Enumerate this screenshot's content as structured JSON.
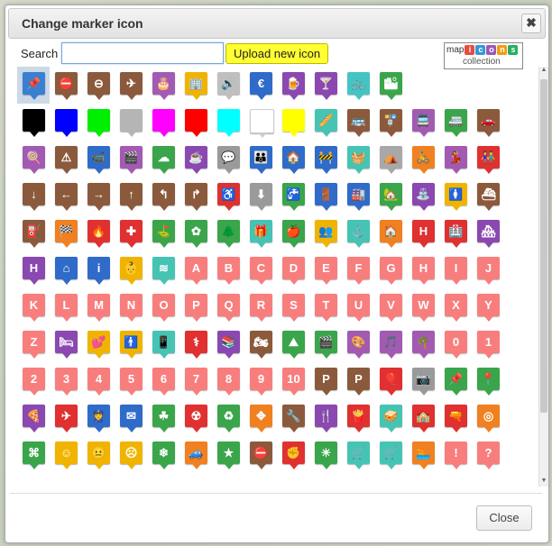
{
  "dialog": {
    "title": "Change marker icon",
    "close_glyph": "✖",
    "search_label": "Search",
    "search_value": "",
    "upload_label": "Upload new icon",
    "close_label": "Close"
  },
  "logo": {
    "prefix": "map",
    "letters": [
      {
        "ch": "i",
        "color": "#e74c3c"
      },
      {
        "ch": "c",
        "color": "#3498db"
      },
      {
        "ch": "o",
        "color": "#9b59b6"
      },
      {
        "ch": "n",
        "color": "#f39c12"
      },
      {
        "ch": "s",
        "color": "#27ae60"
      }
    ],
    "subtitle": "collection"
  },
  "icons": [
    {
      "name": "pushpin-icon",
      "color": "#3a7fd0",
      "glyph": "📌",
      "selected": true
    },
    {
      "name": "no-entry-icon",
      "color": "#8b5a3c",
      "glyph": "⛔"
    },
    {
      "name": "no-entry-alt-icon",
      "color": "#8b5a3c",
      "glyph": "⊖"
    },
    {
      "name": "airport-icon",
      "color": "#8b5a3c",
      "glyph": "✈"
    },
    {
      "name": "birthday-cake-icon",
      "color": "#a35ab3",
      "glyph": "🎂"
    },
    {
      "name": "building-icon",
      "color": "#f0b400",
      "glyph": "🏢"
    },
    {
      "name": "loudspeaker-icon",
      "color": "#bfbfbf",
      "glyph": "🔊"
    },
    {
      "name": "euro-money-icon",
      "color": "#2f6bc9",
      "glyph": "€"
    },
    {
      "name": "beer-icon",
      "color": "#8a48b0",
      "glyph": "🍺"
    },
    {
      "name": "bar-icon",
      "color": "#8a48b0",
      "glyph": "🍸"
    },
    {
      "name": "bicycle-icon",
      "color": "#45c4c4",
      "glyph": "🚲"
    },
    {
      "name": "city-icon",
      "color": "#3aa54a",
      "glyph": "🏙"
    },
    {
      "name": "black-marker-icon",
      "color": "#000000",
      "glyph": ""
    },
    {
      "name": "blue-marker-icon",
      "color": "#0000ff",
      "glyph": ""
    },
    {
      "name": "green-marker-icon",
      "color": "#00ee00",
      "glyph": ""
    },
    {
      "name": "gray-marker-icon",
      "color": "#b5b5b5",
      "glyph": ""
    },
    {
      "name": "magenta-marker-icon",
      "color": "#ff00ff",
      "glyph": ""
    },
    {
      "name": "red-marker-icon",
      "color": "#ff0000",
      "glyph": ""
    },
    {
      "name": "cyan-marker-icon",
      "color": "#00ffff",
      "glyph": ""
    },
    {
      "name": "white-marker-icon",
      "color": "#ffffff",
      "glyph": "",
      "white": true
    },
    {
      "name": "yellow-marker-icon",
      "color": "#ffff00",
      "glyph": ""
    },
    {
      "name": "bakery-icon",
      "color": "#45c4b4",
      "glyph": "🥖"
    },
    {
      "name": "bus-icon",
      "color": "#8b5a3c",
      "glyph": "🚌"
    },
    {
      "name": "bus-stop-icon",
      "color": "#8b5a3c",
      "glyph": "🚏"
    },
    {
      "name": "bus-tour-icon",
      "color": "#a35ab3",
      "glyph": "🚍"
    },
    {
      "name": "camper-icon",
      "color": "#3aa54a",
      "glyph": "🚐"
    },
    {
      "name": "car-icon",
      "color": "#8b5a3c",
      "glyph": "🚗"
    },
    {
      "name": "candy-icon",
      "color": "#a35ab3",
      "glyph": "🍭"
    },
    {
      "name": "caution-icon",
      "color": "#8b5a3c",
      "glyph": "⚠"
    },
    {
      "name": "cctv-icon",
      "color": "#2f6bc9",
      "glyph": "📹"
    },
    {
      "name": "cinema-icon",
      "color": "#a35ab3",
      "glyph": "🎬"
    },
    {
      "name": "cloud-icon",
      "color": "#3aa54a",
      "glyph": "☁"
    },
    {
      "name": "coffee-icon",
      "color": "#8a48b0",
      "glyph": "☕"
    },
    {
      "name": "chat-icon",
      "color": "#9a9a9a",
      "glyph": "💬"
    },
    {
      "name": "community-icon",
      "color": "#2f6bc9",
      "glyph": "👪"
    },
    {
      "name": "conservation-icon",
      "color": "#2f6bc9",
      "glyph": "🏠"
    },
    {
      "name": "construction-icon",
      "color": "#2f6bc9",
      "glyph": "🚧"
    },
    {
      "name": "shopping-basket-icon",
      "color": "#45c4b4",
      "glyph": "🧺"
    },
    {
      "name": "dome-icon",
      "color": "#a8a8a8",
      "glyph": "⛺"
    },
    {
      "name": "cycling-icon",
      "color": "#f08020",
      "glyph": "🚴"
    },
    {
      "name": "dancing-icon",
      "color": "#a35ab3",
      "glyph": "💃"
    },
    {
      "name": "daycare-icon",
      "color": "#e03030",
      "glyph": "👫"
    },
    {
      "name": "arrow-down-icon",
      "color": "#8b5a3c",
      "glyph": "↓"
    },
    {
      "name": "arrow-left-icon",
      "color": "#8b5a3c",
      "glyph": "←"
    },
    {
      "name": "arrow-right-icon",
      "color": "#8b5a3c",
      "glyph": "→"
    },
    {
      "name": "arrow-up-icon",
      "color": "#8b5a3c",
      "glyph": "↑"
    },
    {
      "name": "turn-left-icon",
      "color": "#8b5a3c",
      "glyph": "↰"
    },
    {
      "name": "turn-right-icon",
      "color": "#8b5a3c",
      "glyph": "↱"
    },
    {
      "name": "disability-icon",
      "color": "#e03030",
      "glyph": "♿"
    },
    {
      "name": "download-icon",
      "color": "#9a9a9a",
      "glyph": "⬇"
    },
    {
      "name": "drinking-water-icon",
      "color": "#3aa54a",
      "glyph": "🚰"
    },
    {
      "name": "exit-icon",
      "color": "#2f6bc9",
      "glyph": "🚪"
    },
    {
      "name": "factory-icon",
      "color": "#2f6bc9",
      "glyph": "🏭"
    },
    {
      "name": "farm-icon",
      "color": "#3aa54a",
      "glyph": "🏡"
    },
    {
      "name": "fountain-icon",
      "color": "#8a48b0",
      "glyph": "⛲"
    },
    {
      "name": "woman-icon",
      "color": "#f0b400",
      "glyph": "🚺"
    },
    {
      "name": "ferry-icon",
      "color": "#8b5a3c",
      "glyph": "⛴"
    },
    {
      "name": "gas-station-icon",
      "color": "#8b5a3c",
      "glyph": "⛽"
    },
    {
      "name": "finish-flag-icon",
      "color": "#f08020",
      "glyph": "🏁"
    },
    {
      "name": "fire-icon",
      "color": "#e03030",
      "glyph": "🔥"
    },
    {
      "name": "first-aid-icon",
      "color": "#e03030",
      "glyph": "✚"
    },
    {
      "name": "golf-icon",
      "color": "#3aa54a",
      "glyph": "⛳"
    },
    {
      "name": "flower-icon",
      "color": "#3aa54a",
      "glyph": "✿"
    },
    {
      "name": "forest-icon",
      "color": "#3aa54a",
      "glyph": "🌲"
    },
    {
      "name": "gift-icon",
      "color": "#45c4b4",
      "glyph": "🎁"
    },
    {
      "name": "grocery-icon",
      "color": "#3aa54a",
      "glyph": "🍎"
    },
    {
      "name": "group-icon",
      "color": "#f0b400",
      "glyph": "👥"
    },
    {
      "name": "harbor-icon",
      "color": "#45c4b4",
      "glyph": "⚓"
    },
    {
      "name": "home-icon",
      "color": "#f08020",
      "glyph": "🏠"
    },
    {
      "name": "hospital-icon",
      "color": "#e03030",
      "glyph": "H"
    },
    {
      "name": "hospital-building-icon",
      "color": "#e03030",
      "glyph": "🏥"
    },
    {
      "name": "house-row-icon",
      "color": "#8a48b0",
      "glyph": "🏘"
    },
    {
      "name": "hotel-icon",
      "color": "#8a48b0",
      "glyph": "H"
    },
    {
      "name": "igloo-icon",
      "color": "#2f6bc9",
      "glyph": "⌂"
    },
    {
      "name": "info-icon",
      "color": "#2f6bc9",
      "glyph": "i"
    },
    {
      "name": "kids-icon",
      "color": "#f0b400",
      "glyph": "👶"
    },
    {
      "name": "lake-icon",
      "color": "#45c4b4",
      "glyph": "≋"
    },
    {
      "name": "letter-a-icon",
      "color": "#f87e7e",
      "glyph": "A"
    },
    {
      "name": "letter-b-icon",
      "color": "#f87e7e",
      "glyph": "B"
    },
    {
      "name": "letter-c-icon",
      "color": "#f87e7e",
      "glyph": "C"
    },
    {
      "name": "letter-d-icon",
      "color": "#f87e7e",
      "glyph": "D"
    },
    {
      "name": "letter-e-icon",
      "color": "#f87e7e",
      "glyph": "E"
    },
    {
      "name": "letter-f-icon",
      "color": "#f87e7e",
      "glyph": "F"
    },
    {
      "name": "letter-g-icon",
      "color": "#f87e7e",
      "glyph": "G"
    },
    {
      "name": "letter-h-icon",
      "color": "#f87e7e",
      "glyph": "H"
    },
    {
      "name": "letter-i-icon",
      "color": "#f87e7e",
      "glyph": "I"
    },
    {
      "name": "letter-j-icon",
      "color": "#f87e7e",
      "glyph": "J"
    },
    {
      "name": "letter-k-icon",
      "color": "#f87e7e",
      "glyph": "K"
    },
    {
      "name": "letter-l-icon",
      "color": "#f87e7e",
      "glyph": "L"
    },
    {
      "name": "letter-m-icon",
      "color": "#f87e7e",
      "glyph": "M"
    },
    {
      "name": "letter-n-icon",
      "color": "#f87e7e",
      "glyph": "N"
    },
    {
      "name": "letter-o-icon",
      "color": "#f87e7e",
      "glyph": "O"
    },
    {
      "name": "letter-p-icon",
      "color": "#f87e7e",
      "glyph": "P"
    },
    {
      "name": "letter-q-icon",
      "color": "#f87e7e",
      "glyph": "Q"
    },
    {
      "name": "letter-r-icon",
      "color": "#f87e7e",
      "glyph": "R"
    },
    {
      "name": "letter-s-icon",
      "color": "#f87e7e",
      "glyph": "S"
    },
    {
      "name": "letter-t-icon",
      "color": "#f87e7e",
      "glyph": "T"
    },
    {
      "name": "letter-u-icon",
      "color": "#f87e7e",
      "glyph": "U"
    },
    {
      "name": "letter-v-icon",
      "color": "#f87e7e",
      "glyph": "V"
    },
    {
      "name": "letter-w-icon",
      "color": "#f87e7e",
      "glyph": "W"
    },
    {
      "name": "letter-x-icon",
      "color": "#f87e7e",
      "glyph": "X"
    },
    {
      "name": "letter-y-icon",
      "color": "#f87e7e",
      "glyph": "Y"
    },
    {
      "name": "letter-z-icon",
      "color": "#f87e7e",
      "glyph": "Z"
    },
    {
      "name": "lodging-icon",
      "color": "#8a48b0",
      "glyph": "🛏"
    },
    {
      "name": "love-icon",
      "color": "#f0b400",
      "glyph": "💕"
    },
    {
      "name": "man-icon",
      "color": "#f0b400",
      "glyph": "🚹"
    },
    {
      "name": "mobile-phone-icon",
      "color": "#45c4b4",
      "glyph": "📱"
    },
    {
      "name": "medicine-icon",
      "color": "#e03030",
      "glyph": "⚕"
    },
    {
      "name": "library-icon",
      "color": "#8a48b0",
      "glyph": "📚"
    },
    {
      "name": "motorbike-icon",
      "color": "#8b5a3c",
      "glyph": "🏍"
    },
    {
      "name": "mountains-icon",
      "color": "#3aa54a",
      "glyph": "⛰"
    },
    {
      "name": "movie-icon",
      "color": "#3aa54a",
      "glyph": "🎬"
    },
    {
      "name": "painting-icon",
      "color": "#a35ab3",
      "glyph": "🎨"
    },
    {
      "name": "music-icon",
      "color": "#a35ab3",
      "glyph": "🎵"
    },
    {
      "name": "palm-tree-icon",
      "color": "#a35ab3",
      "glyph": "🌴"
    },
    {
      "name": "number-0-icon",
      "color": "#f87e7e",
      "glyph": "0"
    },
    {
      "name": "number-1-icon",
      "color": "#f87e7e",
      "glyph": "1"
    },
    {
      "name": "number-2-icon",
      "color": "#f87e7e",
      "glyph": "2"
    },
    {
      "name": "number-3-icon",
      "color": "#f87e7e",
      "glyph": "3"
    },
    {
      "name": "number-4-icon",
      "color": "#f87e7e",
      "glyph": "4"
    },
    {
      "name": "number-5-icon",
      "color": "#f87e7e",
      "glyph": "5"
    },
    {
      "name": "number-6-icon",
      "color": "#f87e7e",
      "glyph": "6"
    },
    {
      "name": "number-7-icon",
      "color": "#f87e7e",
      "glyph": "7"
    },
    {
      "name": "number-8-icon",
      "color": "#f87e7e",
      "glyph": "8"
    },
    {
      "name": "number-9-icon",
      "color": "#f87e7e",
      "glyph": "9"
    },
    {
      "name": "number-10-icon",
      "color": "#f87e7e",
      "glyph": "10"
    },
    {
      "name": "parking-icon",
      "color": "#8b5a3c",
      "glyph": "P"
    },
    {
      "name": "parking-garage-icon",
      "color": "#8b5a3c",
      "glyph": "P"
    },
    {
      "name": "party-balloons-icon",
      "color": "#e03030",
      "glyph": "🎈"
    },
    {
      "name": "photo-icon",
      "color": "#9a9a9a",
      "glyph": "📷"
    },
    {
      "name": "pin-icon",
      "color": "#3aa54a",
      "glyph": "📌"
    },
    {
      "name": "location-icon",
      "color": "#3aa54a",
      "glyph": "📍"
    },
    {
      "name": "pizza-icon",
      "color": "#8a48b0",
      "glyph": "🍕"
    },
    {
      "name": "plane-crash-icon",
      "color": "#e03030",
      "glyph": "✈"
    },
    {
      "name": "police-icon",
      "color": "#2f6bc9",
      "glyph": "👮"
    },
    {
      "name": "post-office-icon",
      "color": "#2f6bc9",
      "glyph": "✉"
    },
    {
      "name": "clover-icon",
      "color": "#3aa54a",
      "glyph": "☘"
    },
    {
      "name": "radiation-icon",
      "color": "#e03030",
      "glyph": "☢"
    },
    {
      "name": "recycle-icon",
      "color": "#3aa54a",
      "glyph": "♻"
    },
    {
      "name": "roundabout-icon",
      "color": "#f08020",
      "glyph": "✥"
    },
    {
      "name": "repair-icon",
      "color": "#8b5a3c",
      "glyph": "🔧"
    },
    {
      "name": "restaurant-icon",
      "color": "#8a48b0",
      "glyph": "🍴"
    },
    {
      "name": "fast-food-icon",
      "color": "#e03030",
      "glyph": "🍟"
    },
    {
      "name": "sandwich-icon",
      "color": "#45c4b4",
      "glyph": "🥪"
    },
    {
      "name": "school-icon",
      "color": "#e03030",
      "glyph": "🏫"
    },
    {
      "name": "shooting-icon",
      "color": "#e03030",
      "glyph": "🔫"
    },
    {
      "name": "target-icon",
      "color": "#f08020",
      "glyph": "◎"
    },
    {
      "name": "command-icon",
      "color": "#3aa54a",
      "glyph": "⌘"
    },
    {
      "name": "smiley-happy-icon",
      "color": "#f0b400",
      "glyph": "☺"
    },
    {
      "name": "smiley-neutral-icon",
      "color": "#f0b400",
      "glyph": "😐"
    },
    {
      "name": "smiley-sad-icon",
      "color": "#f0b400",
      "glyph": "☹"
    },
    {
      "name": "snowflake-icon",
      "color": "#3aa54a",
      "glyph": "❄"
    },
    {
      "name": "sports-car-icon",
      "color": "#f08020",
      "glyph": "🚙"
    },
    {
      "name": "star-icon",
      "color": "#3aa54a",
      "glyph": "★"
    },
    {
      "name": "stop-sign-icon",
      "color": "#8b5a3c",
      "glyph": "⛔"
    },
    {
      "name": "strike-icon",
      "color": "#e03030",
      "glyph": "✊"
    },
    {
      "name": "sun-icon",
      "color": "#3aa54a",
      "glyph": "☀"
    },
    {
      "name": "supermarket-icon",
      "color": "#45c4b4",
      "glyph": "🛒"
    },
    {
      "name": "supermarket-alt-icon",
      "color": "#45c4b4",
      "glyph": "🛒"
    },
    {
      "name": "swimming-icon",
      "color": "#f08020",
      "glyph": "🏊"
    },
    {
      "name": "exclamation-icon",
      "color": "#f87e7e",
      "glyph": "!"
    },
    {
      "name": "question-icon",
      "color": "#f87e7e",
      "glyph": "?"
    }
  ]
}
